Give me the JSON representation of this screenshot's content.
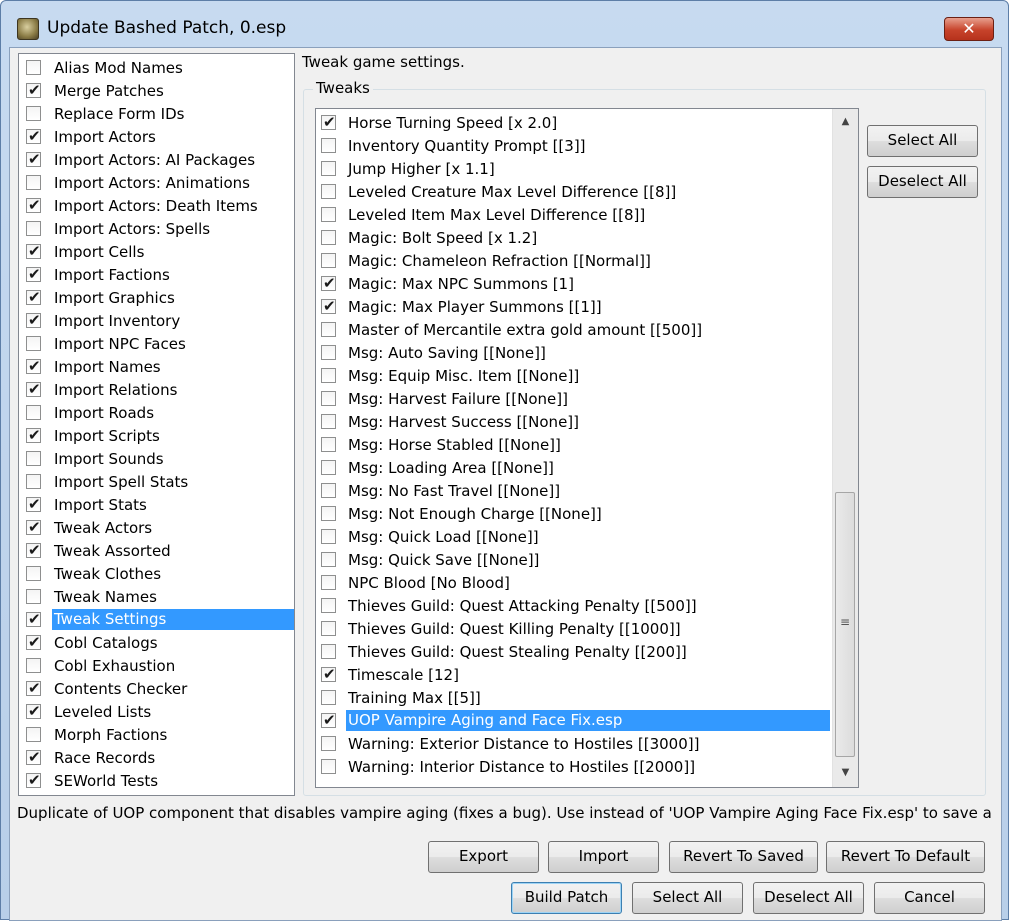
{
  "window": {
    "title": "Update Bashed Patch, 0.esp",
    "close_label": "✕"
  },
  "left_items": [
    {
      "label": "Alias Mod Names",
      "checked": false
    },
    {
      "label": "Merge Patches",
      "checked": true
    },
    {
      "label": "Replace Form IDs",
      "checked": false
    },
    {
      "label": "Import Actors",
      "checked": true
    },
    {
      "label": "Import Actors: AI Packages",
      "checked": true
    },
    {
      "label": "Import Actors: Animations",
      "checked": false
    },
    {
      "label": "Import Actors: Death Items",
      "checked": true
    },
    {
      "label": "Import Actors: Spells",
      "checked": false
    },
    {
      "label": "Import Cells",
      "checked": true
    },
    {
      "label": "Import Factions",
      "checked": true
    },
    {
      "label": "Import Graphics",
      "checked": true
    },
    {
      "label": "Import Inventory",
      "checked": true
    },
    {
      "label": "Import NPC Faces",
      "checked": false
    },
    {
      "label": "Import Names",
      "checked": true
    },
    {
      "label": "Import Relations",
      "checked": true
    },
    {
      "label": "Import Roads",
      "checked": false
    },
    {
      "label": "Import Scripts",
      "checked": true
    },
    {
      "label": "Import Sounds",
      "checked": false
    },
    {
      "label": "Import Spell Stats",
      "checked": false
    },
    {
      "label": "Import Stats",
      "checked": true
    },
    {
      "label": "Tweak Actors",
      "checked": true
    },
    {
      "label": "Tweak Assorted",
      "checked": true
    },
    {
      "label": "Tweak Clothes",
      "checked": false
    },
    {
      "label": "Tweak Names",
      "checked": false
    },
    {
      "label": "Tweak Settings",
      "checked": true,
      "selected": true
    },
    {
      "label": "Cobl Catalogs",
      "checked": true
    },
    {
      "label": "Cobl Exhaustion",
      "checked": false
    },
    {
      "label": "Contents Checker",
      "checked": true
    },
    {
      "label": "Leveled Lists",
      "checked": true
    },
    {
      "label": "Morph Factions",
      "checked": false
    },
    {
      "label": "Race Records",
      "checked": true
    },
    {
      "label": "SEWorld Tests",
      "checked": true
    }
  ],
  "description": "Tweak game settings.",
  "tweaks_group_label": "Tweaks",
  "tweaks": [
    {
      "label": "Horse Turning Speed [x 2.0]",
      "checked": true
    },
    {
      "label": "Inventory Quantity Prompt [[3]]",
      "checked": false
    },
    {
      "label": "Jump Higher [x 1.1]",
      "checked": false
    },
    {
      "label": "Leveled Creature Max Level Difference [[8]]",
      "checked": false
    },
    {
      "label": "Leveled Item Max Level Difference [[8]]",
      "checked": false
    },
    {
      "label": "Magic: Bolt Speed [x 1.2]",
      "checked": false
    },
    {
      "label": "Magic: Chameleon Refraction [[Normal]]",
      "checked": false
    },
    {
      "label": "Magic: Max NPC Summons [1]",
      "checked": true
    },
    {
      "label": "Magic: Max Player Summons [[1]]",
      "checked": true
    },
    {
      "label": "Master of Mercantile extra gold amount [[500]]",
      "checked": false
    },
    {
      "label": "Msg: Auto Saving [[None]]",
      "checked": false
    },
    {
      "label": "Msg: Equip Misc. Item [[None]]",
      "checked": false
    },
    {
      "label": "Msg: Harvest Failure [[None]]",
      "checked": false
    },
    {
      "label": "Msg: Harvest Success [[None]]",
      "checked": false
    },
    {
      "label": "Msg: Horse Stabled [[None]]",
      "checked": false
    },
    {
      "label": "Msg: Loading Area [[None]]",
      "checked": false
    },
    {
      "label": "Msg: No Fast Travel [[None]]",
      "checked": false
    },
    {
      "label": "Msg: Not Enough Charge [[None]]",
      "checked": false
    },
    {
      "label": "Msg: Quick Load [[None]]",
      "checked": false
    },
    {
      "label": "Msg: Quick Save [[None]]",
      "checked": false
    },
    {
      "label": "NPC Blood [No Blood]",
      "checked": false
    },
    {
      "label": "Thieves Guild: Quest Attacking Penalty [[500]]",
      "checked": false
    },
    {
      "label": "Thieves Guild: Quest Killing Penalty [[1000]]",
      "checked": false
    },
    {
      "label": "Thieves Guild: Quest Stealing Penalty [[200]]",
      "checked": false
    },
    {
      "label": "Timescale [12]",
      "checked": true
    },
    {
      "label": "Training Max [[5]]",
      "checked": false
    },
    {
      "label": "UOP Vampire Aging and Face Fix.esp",
      "checked": true,
      "selected": true
    },
    {
      "label": "Warning: Exterior Distance to Hostiles [[3000]]",
      "checked": false
    },
    {
      "label": "Warning: Interior Distance to Hostiles [[2000]]",
      "checked": false
    }
  ],
  "tweak_buttons": {
    "select_all": "Select All",
    "deselect_all": "Deselect All"
  },
  "status_text": "Duplicate of UOP component that disables vampire aging (fixes a bug). Use instead of 'UOP Vampire Aging  Face Fix.esp' to save an e",
  "bottom_buttons": {
    "export": "Export",
    "import": "Import",
    "revert_saved": "Revert To Saved",
    "revert_default": "Revert To Default",
    "build_patch": "Build Patch",
    "select_all": "Select All",
    "deselect_all": "Deselect All",
    "cancel": "Cancel"
  },
  "scrollbar": {
    "up_icon": "▲",
    "down_icon": "▼",
    "grip_icon": "≡"
  }
}
